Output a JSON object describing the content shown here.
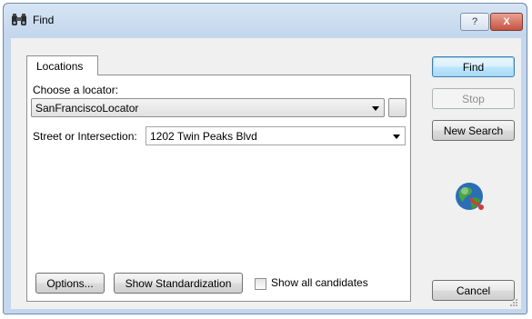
{
  "window": {
    "title": "Find",
    "help_label": "?",
    "close_label": "X"
  },
  "tab": {
    "label": "Locations"
  },
  "locator": {
    "label": "Choose a locator:",
    "value": "SanFranciscoLocator"
  },
  "street": {
    "label": "Street or Intersection:",
    "value": "1202 Twin Peaks Blvd"
  },
  "bottom": {
    "options_label": "Options...",
    "standardization_label": "Show Standardization",
    "candidates_label": "Show all candidates",
    "candidates_checked": false
  },
  "side_buttons": {
    "find": "Find",
    "stop": "Stop",
    "new_search": "New Search",
    "cancel": "Cancel"
  },
  "icons": {
    "title": "binoculars-icon",
    "globe": "globe-locator-icon"
  }
}
